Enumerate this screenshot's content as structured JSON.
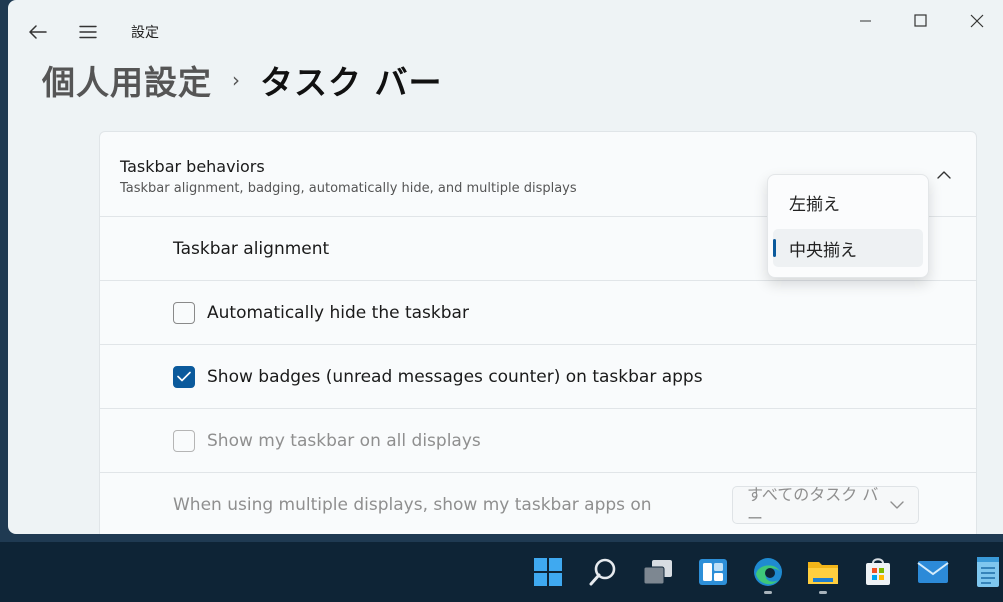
{
  "window": {
    "app_title": "設定",
    "breadcrumb": {
      "parent": "個人用設定",
      "separator": "›",
      "current": "タスク バー"
    }
  },
  "section": {
    "title": "Taskbar behaviors",
    "subtitle": "Taskbar alignment, badging, automatically hide, and multiple displays",
    "expanded": true
  },
  "settings": {
    "alignment": {
      "label": "Taskbar alignment",
      "dropdown_options": [
        "左揃え",
        "中央揃え"
      ],
      "selected": "中央揃え"
    },
    "auto_hide": {
      "label": "Automatically hide the taskbar",
      "checked": false
    },
    "badges": {
      "label": "Show badges (unread messages counter) on taskbar apps",
      "checked": true
    },
    "all_displays": {
      "label": "Show my taskbar on all displays",
      "checked": false,
      "disabled": true
    },
    "multi_display": {
      "label": "When using multiple displays, show my taskbar apps on",
      "value": "すべてのタスク バー",
      "disabled": true
    }
  },
  "taskbar": {
    "icons": [
      "start-icon",
      "search-icon",
      "task-view-icon",
      "widgets-icon",
      "edge-icon",
      "file-explorer-icon",
      "store-icon",
      "mail-icon",
      "notepad-icon"
    ]
  },
  "colors": {
    "accent": "#0b5a9c",
    "window_bg": "#eef3f5",
    "taskbar_bg": "#0e2436"
  }
}
